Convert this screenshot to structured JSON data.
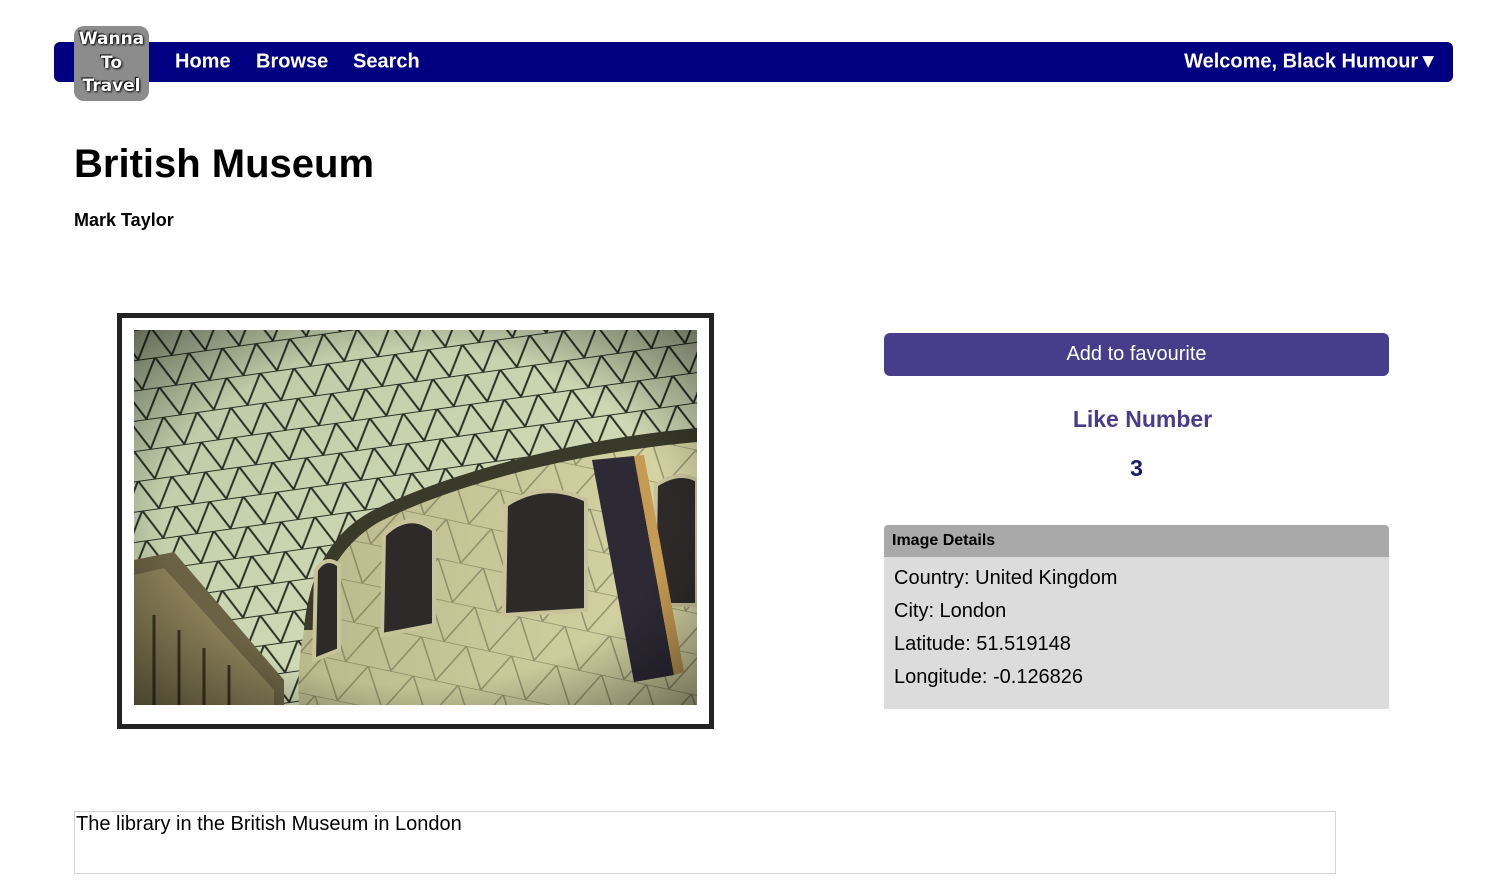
{
  "header": {
    "logo_lines": [
      "Wanna",
      "To",
      "Travel"
    ],
    "nav": {
      "home": "Home",
      "browse": "Browse",
      "search": "Search"
    },
    "user_menu": "Welcome, Black Humour▼"
  },
  "main": {
    "title": "British Museum",
    "author": "Mark Taylor",
    "photo_icon": "british-museum-great-court-photo"
  },
  "panel": {
    "favourite_button": "Add to favourite",
    "like_label": "Like Number",
    "like_count": "3",
    "details": {
      "header": "Image Details",
      "country": "Country: United Kingdom",
      "city": "City: London",
      "latitude": "Latitude: 51.519148",
      "longitude": "Longitude: -0.126826"
    }
  },
  "description": "The library in the British Museum in London",
  "colors": {
    "nav_bg": "#000080",
    "button_bg": "#483d8b",
    "like_label": "#483d8b",
    "like_count": "#191970",
    "details_header_bg": "#a9a9a9",
    "details_bg": "#dcdcdc"
  }
}
